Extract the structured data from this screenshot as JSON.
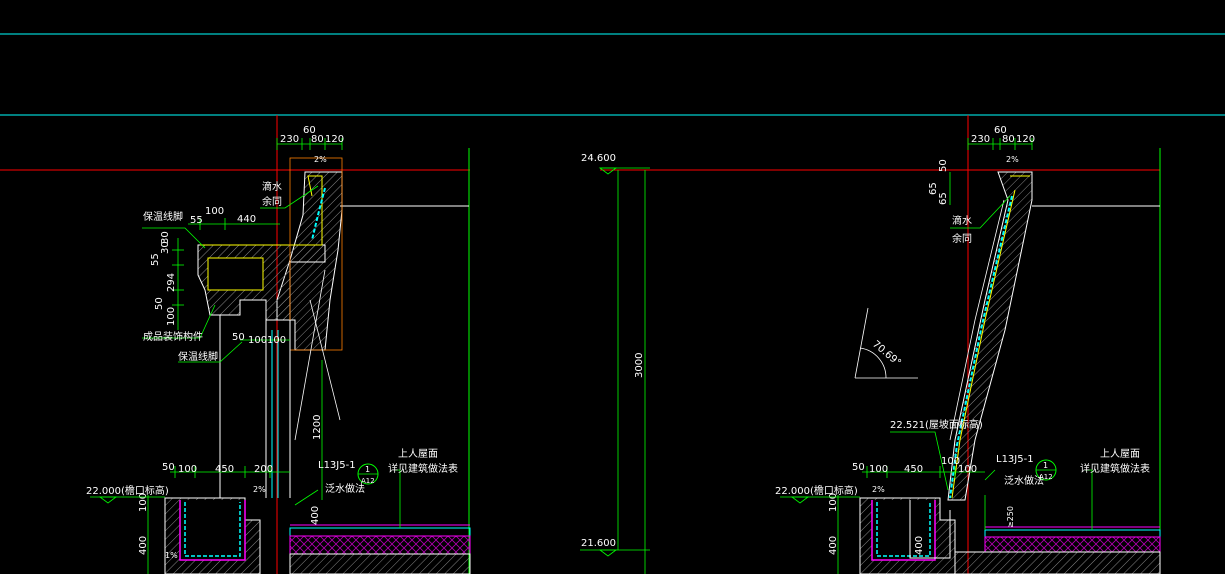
{
  "colors": {
    "background": "#000000",
    "cyan": "#00ffff",
    "red": "#ff0000",
    "yellow": "#ffff00",
    "green": "#00ff00",
    "white": "#ffffff",
    "magenta": "#ff00ff",
    "orange": "#ff7f00"
  },
  "left_detail": {
    "dims_top": [
      "230",
      "60",
      "80",
      "120"
    ],
    "slope_pct": "2%",
    "dim_100": "100",
    "dim_55": "55",
    "dim_440": "440",
    "vert_dims": [
      "55",
      "30",
      "30",
      "294",
      "50",
      "100"
    ],
    "dim_50": "50",
    "dim_100b": "100",
    "dim_100c": "100",
    "dim_1200": "1200",
    "bottom_dims": [
      "50",
      "100",
      "450",
      "200"
    ],
    "dim_400a": "400",
    "dim_100v": "100",
    "dim_400b": "400",
    "slope_bottom": "2%",
    "slope_1pct": "1%",
    "labels": {
      "drip_1": "滴水",
      "drip_2": "余同",
      "insul_top": "保温线脚",
      "prefab": "成品装饰构件",
      "insul_bottom": "保温线脚",
      "ref": "L13J5-1",
      "ref_circle_top": "1",
      "ref_circle_bot": "A12",
      "flashing": "泛水做法",
      "roof_1": "上人屋面",
      "roof_2": "详见建筑做法表"
    },
    "elevation": "22.000(檐口标高)"
  },
  "right_detail": {
    "dims_top": [
      "230",
      "60",
      "80",
      "120"
    ],
    "slope_pct": "2%",
    "vert_dims": [
      "50",
      "65",
      "65"
    ],
    "angle": "70.69°",
    "labels": {
      "drip_1": "滴水",
      "drip_2": "余同",
      "slope_elev": "22.521(屋坡面标高)",
      "ref": "L13J5-1",
      "ref_circle_top": "1",
      "ref_circle_bot": "A12",
      "flashing": "泛水做法",
      "roof_1": "上人屋面",
      "roof_2": "详见建筑做法表"
    },
    "bottom_dims": [
      "50",
      "100",
      "450",
      "100",
      "100"
    ],
    "dim_250": "≥250",
    "dim_100v": "100",
    "dim_400a": "400",
    "dim_400b": "400",
    "slope_bottom": "2%",
    "elevation": "22.000(檐口标高)",
    "elevation_top": "24.600",
    "elevation_bottom": "21.600",
    "height_dim": "3000"
  }
}
